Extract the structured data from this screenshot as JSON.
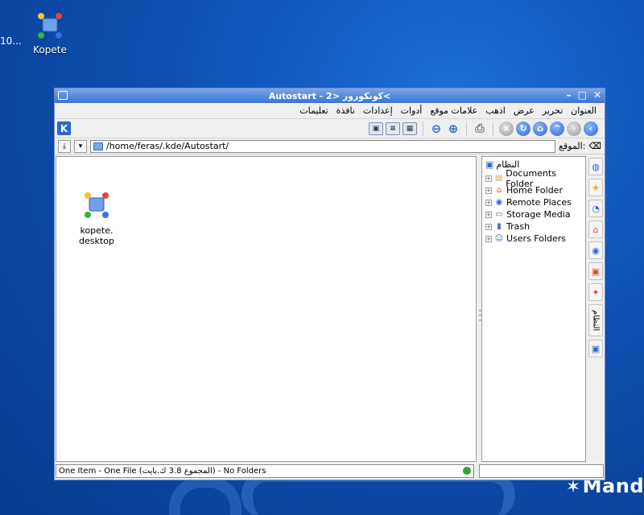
{
  "desktop": {
    "clipped_label": "10...",
    "kopete_label": "Kopete",
    "brand_text": "Mand",
    "accent": "#0d4fb0"
  },
  "window": {
    "title": "Autostart - 2> كونكورور<",
    "menu": [
      "العنوان",
      "تحرير",
      "عرض",
      "اذهب",
      "علامات موقع",
      "أدوات",
      "إعدادات",
      "نافذة",
      "تعليمات"
    ],
    "toolbar_icons": [
      "back-icon",
      "forward-icon",
      "up-icon",
      "home-icon",
      "reload-icon",
      "stop-icon",
      "print-icon",
      "zoom-in-icon",
      "zoom-out-icon",
      "view-icon",
      "view-mode-icon",
      "preview-icon"
    ]
  },
  "location": {
    "label": "الموقع:",
    "path": "/home/feras/.kde/Autostart/"
  },
  "files": [
    {
      "name_line1": "kopete.",
      "name_line2": "desktop"
    }
  ],
  "tree": {
    "root": "النظام",
    "items": [
      {
        "label": "Documents Folder",
        "icon": "documents-folder-icon"
      },
      {
        "label": "Home Folder",
        "icon": "home-folder-icon"
      },
      {
        "label": "Remote Places",
        "icon": "remote-places-icon"
      },
      {
        "label": "Storage Media",
        "icon": "storage-media-icon"
      },
      {
        "label": "Trash",
        "icon": "trash-icon"
      },
      {
        "label": "Users Folders",
        "icon": "users-folders-icon"
      }
    ]
  },
  "sidebar_tab_label": "النظام",
  "status": {
    "text": "One Item - One File (المجموع 3.8 ك.بايت) - No Folders"
  }
}
